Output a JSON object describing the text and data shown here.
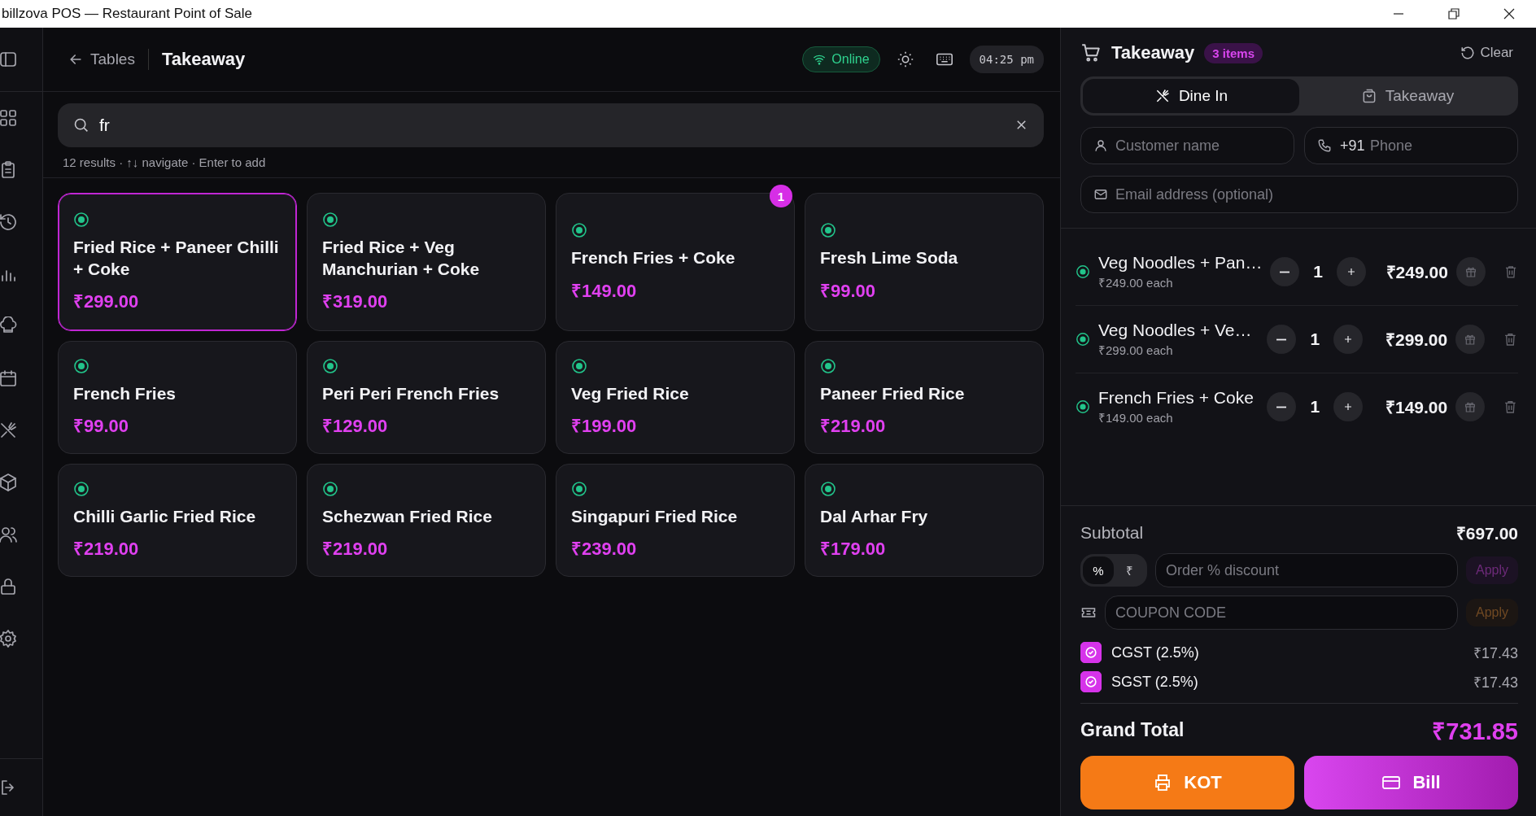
{
  "window": {
    "title": "billzova POS — Restaurant Point of Sale"
  },
  "header": {
    "back_label": "Tables",
    "title": "Takeaway",
    "status": "Online",
    "online": true,
    "time": "04:25 pm"
  },
  "search": {
    "value": "fr",
    "hint": "12 results · ↑↓ navigate · Enter to add"
  },
  "menu_items": [
    {
      "name": "Fried Rice + Paneer Chilli + Coke",
      "price": "₹299.00",
      "selected": true
    },
    {
      "name": "Fried Rice + Veg Manchurian + Coke",
      "price": "₹319.00",
      "selected": false
    },
    {
      "name": "French Fries + Coke",
      "price": "₹149.00",
      "selected": false,
      "cart_qty": "1"
    },
    {
      "name": "Fresh Lime Soda",
      "price": "₹99.00",
      "selected": false
    },
    {
      "name": "French Fries",
      "price": "₹99.00",
      "selected": false
    },
    {
      "name": "Peri Peri French Fries",
      "price": "₹129.00",
      "selected": false
    },
    {
      "name": "Veg Fried Rice",
      "price": "₹199.00",
      "selected": false
    },
    {
      "name": "Paneer Fried Rice",
      "price": "₹219.00",
      "selected": false
    },
    {
      "name": "Chilli Garlic Fried Rice",
      "price": "₹219.00",
      "selected": false
    },
    {
      "name": "Schezwan Fried Rice",
      "price": "₹219.00",
      "selected": false
    },
    {
      "name": "Singapuri Fried Rice",
      "price": "₹239.00",
      "selected": false
    },
    {
      "name": "Dal Arhar Fry",
      "price": "₹179.00",
      "selected": false
    }
  ],
  "order": {
    "title": "Takeaway",
    "count": "3 items",
    "clear_label": "Clear",
    "modes": [
      {
        "label": "Dine In",
        "kind": "dine-in",
        "selected": true
      },
      {
        "label": "Takeaway",
        "kind": "takeaway",
        "selected": false
      }
    ],
    "customer_name": {
      "placeholder": "Customer name"
    },
    "phone": {
      "prefix": "+91",
      "placeholder": "Phone"
    },
    "email": {
      "placeholder": "Email address (optional)"
    },
    "items": [
      {
        "name": "Veg Noodles + Pan…",
        "each": "₹249.00 each",
        "qty": "1",
        "total": "₹249.00"
      },
      {
        "name": "Veg Noodles + Ve…",
        "each": "₹299.00 each",
        "qty": "1",
        "total": "₹299.00"
      },
      {
        "name": "French Fries + Coke",
        "each": "₹149.00 each",
        "qty": "1",
        "total": "₹149.00"
      }
    ],
    "subtotal": {
      "label": "Subtotal",
      "value": "₹697.00"
    },
    "discount_types": [
      {
        "label": "%",
        "selected": true
      },
      {
        "label": "₹",
        "selected": false
      }
    ],
    "discount": {
      "placeholder": "Order % discount",
      "apply": "Apply",
      "disabled": true
    },
    "coupon": {
      "placeholder": "COUPON CODE",
      "apply": "Apply",
      "disabled": true
    },
    "taxes": [
      {
        "label": "CGST (2.5%)",
        "checked": true,
        "amount": "₹17.43"
      },
      {
        "label": "SGST (2.5%)",
        "checked": true,
        "amount": "₹17.43"
      }
    ],
    "grand_total": {
      "label": "Grand Total",
      "value": "₹731.85"
    },
    "actions": [
      {
        "label": "KOT",
        "kind": "kot"
      },
      {
        "label": "Bill",
        "kind": "bill"
      }
    ]
  }
}
